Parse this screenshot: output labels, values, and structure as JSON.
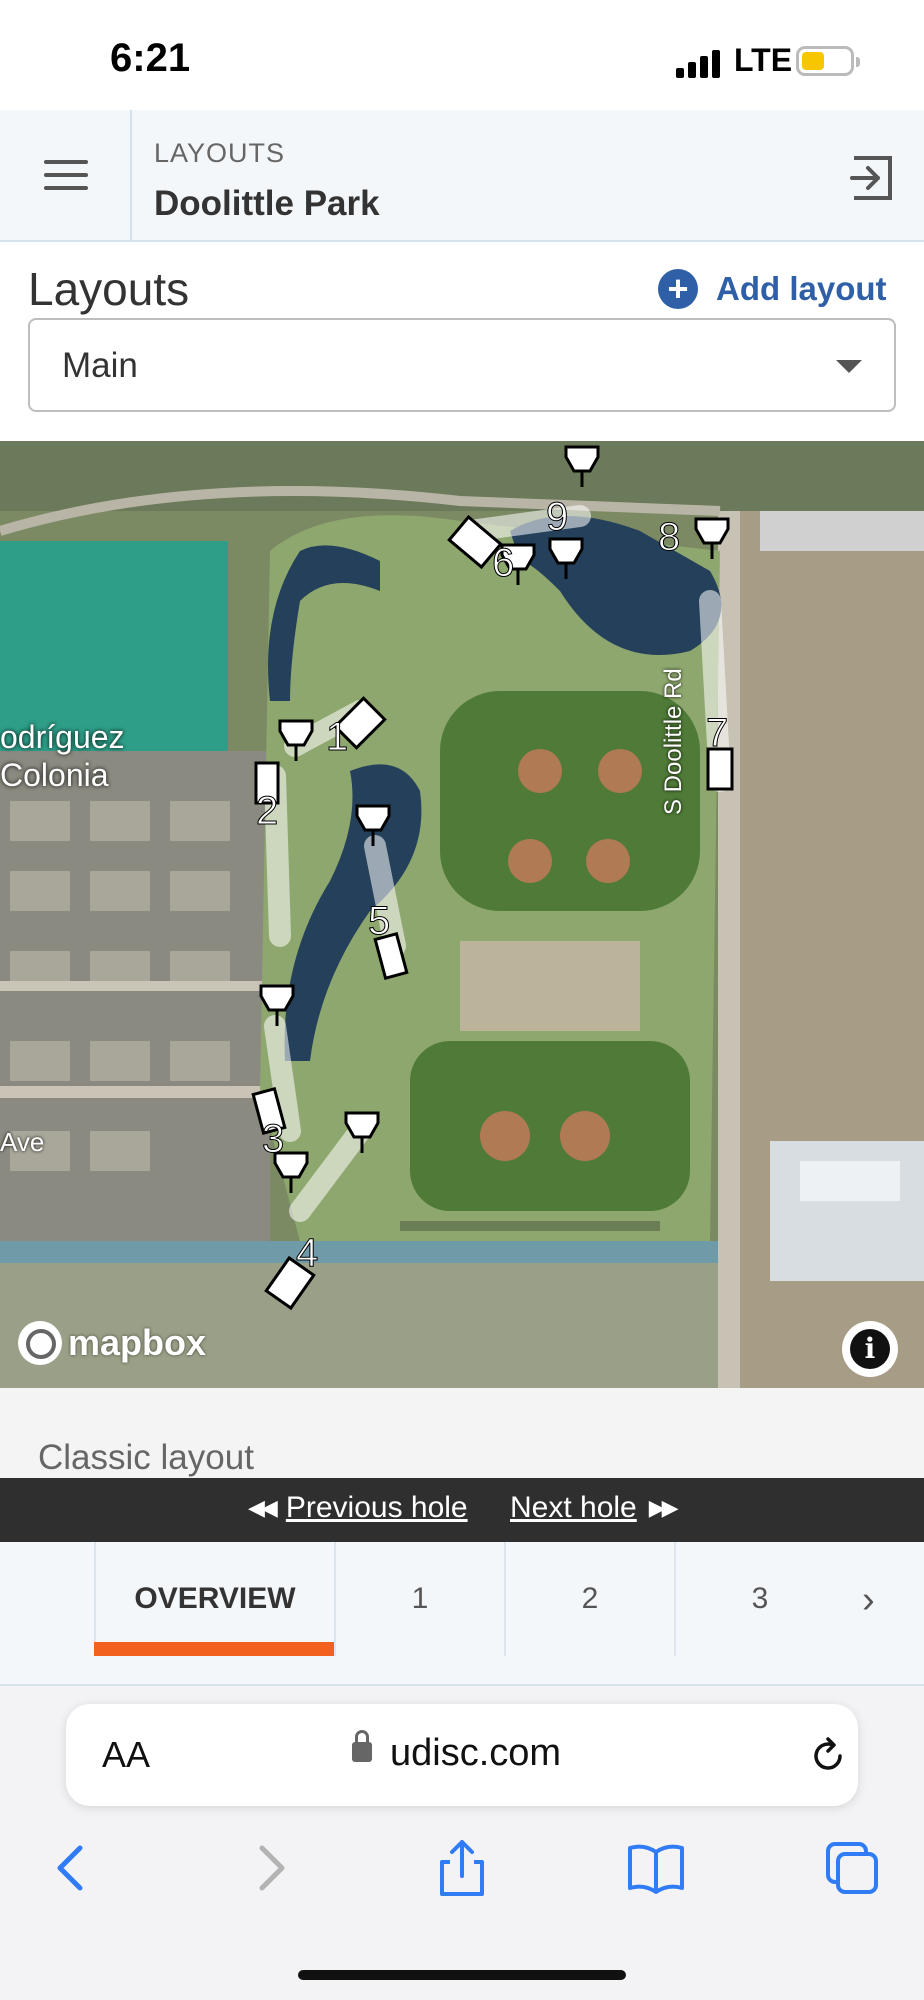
{
  "status_bar": {
    "time": "6:21",
    "network": "LTE",
    "icons": [
      "signal-icon",
      "battery-icon"
    ]
  },
  "header": {
    "breadcrumb": "LAYOUTS",
    "title": "Doolittle Park",
    "icons": [
      "hamburger-icon",
      "exit-icon"
    ]
  },
  "layouts": {
    "heading": "Layouts",
    "add_label": "Add layout",
    "selected": "Main"
  },
  "map": {
    "labels": {
      "area_line1": "odríguez",
      "area_line2": "Colonia",
      "road": "S Doolittle Rd",
      "street": "Ave"
    },
    "holes": [
      "1",
      "2",
      "3",
      "4",
      "5",
      "6",
      "7",
      "8",
      "9"
    ],
    "attribution": "mapbox",
    "colors": {
      "water": "#24405a",
      "pond": "#2e9e88",
      "grass": "#7a9460",
      "field": "#4f7a37",
      "infield": "#b07a55"
    }
  },
  "classic_layout_label": "Classic layout",
  "hole_nav": {
    "previous": "Previous hole",
    "next": "Next hole"
  },
  "tabs": [
    "OVERVIEW",
    "1",
    "2",
    "3"
  ],
  "accent_color": "#f2611d",
  "browser": {
    "aa": "AA",
    "url": "udisc.com",
    "icons": [
      "back-icon",
      "forward-icon",
      "share-icon",
      "bookmarks-icon",
      "tabs-icon"
    ]
  }
}
